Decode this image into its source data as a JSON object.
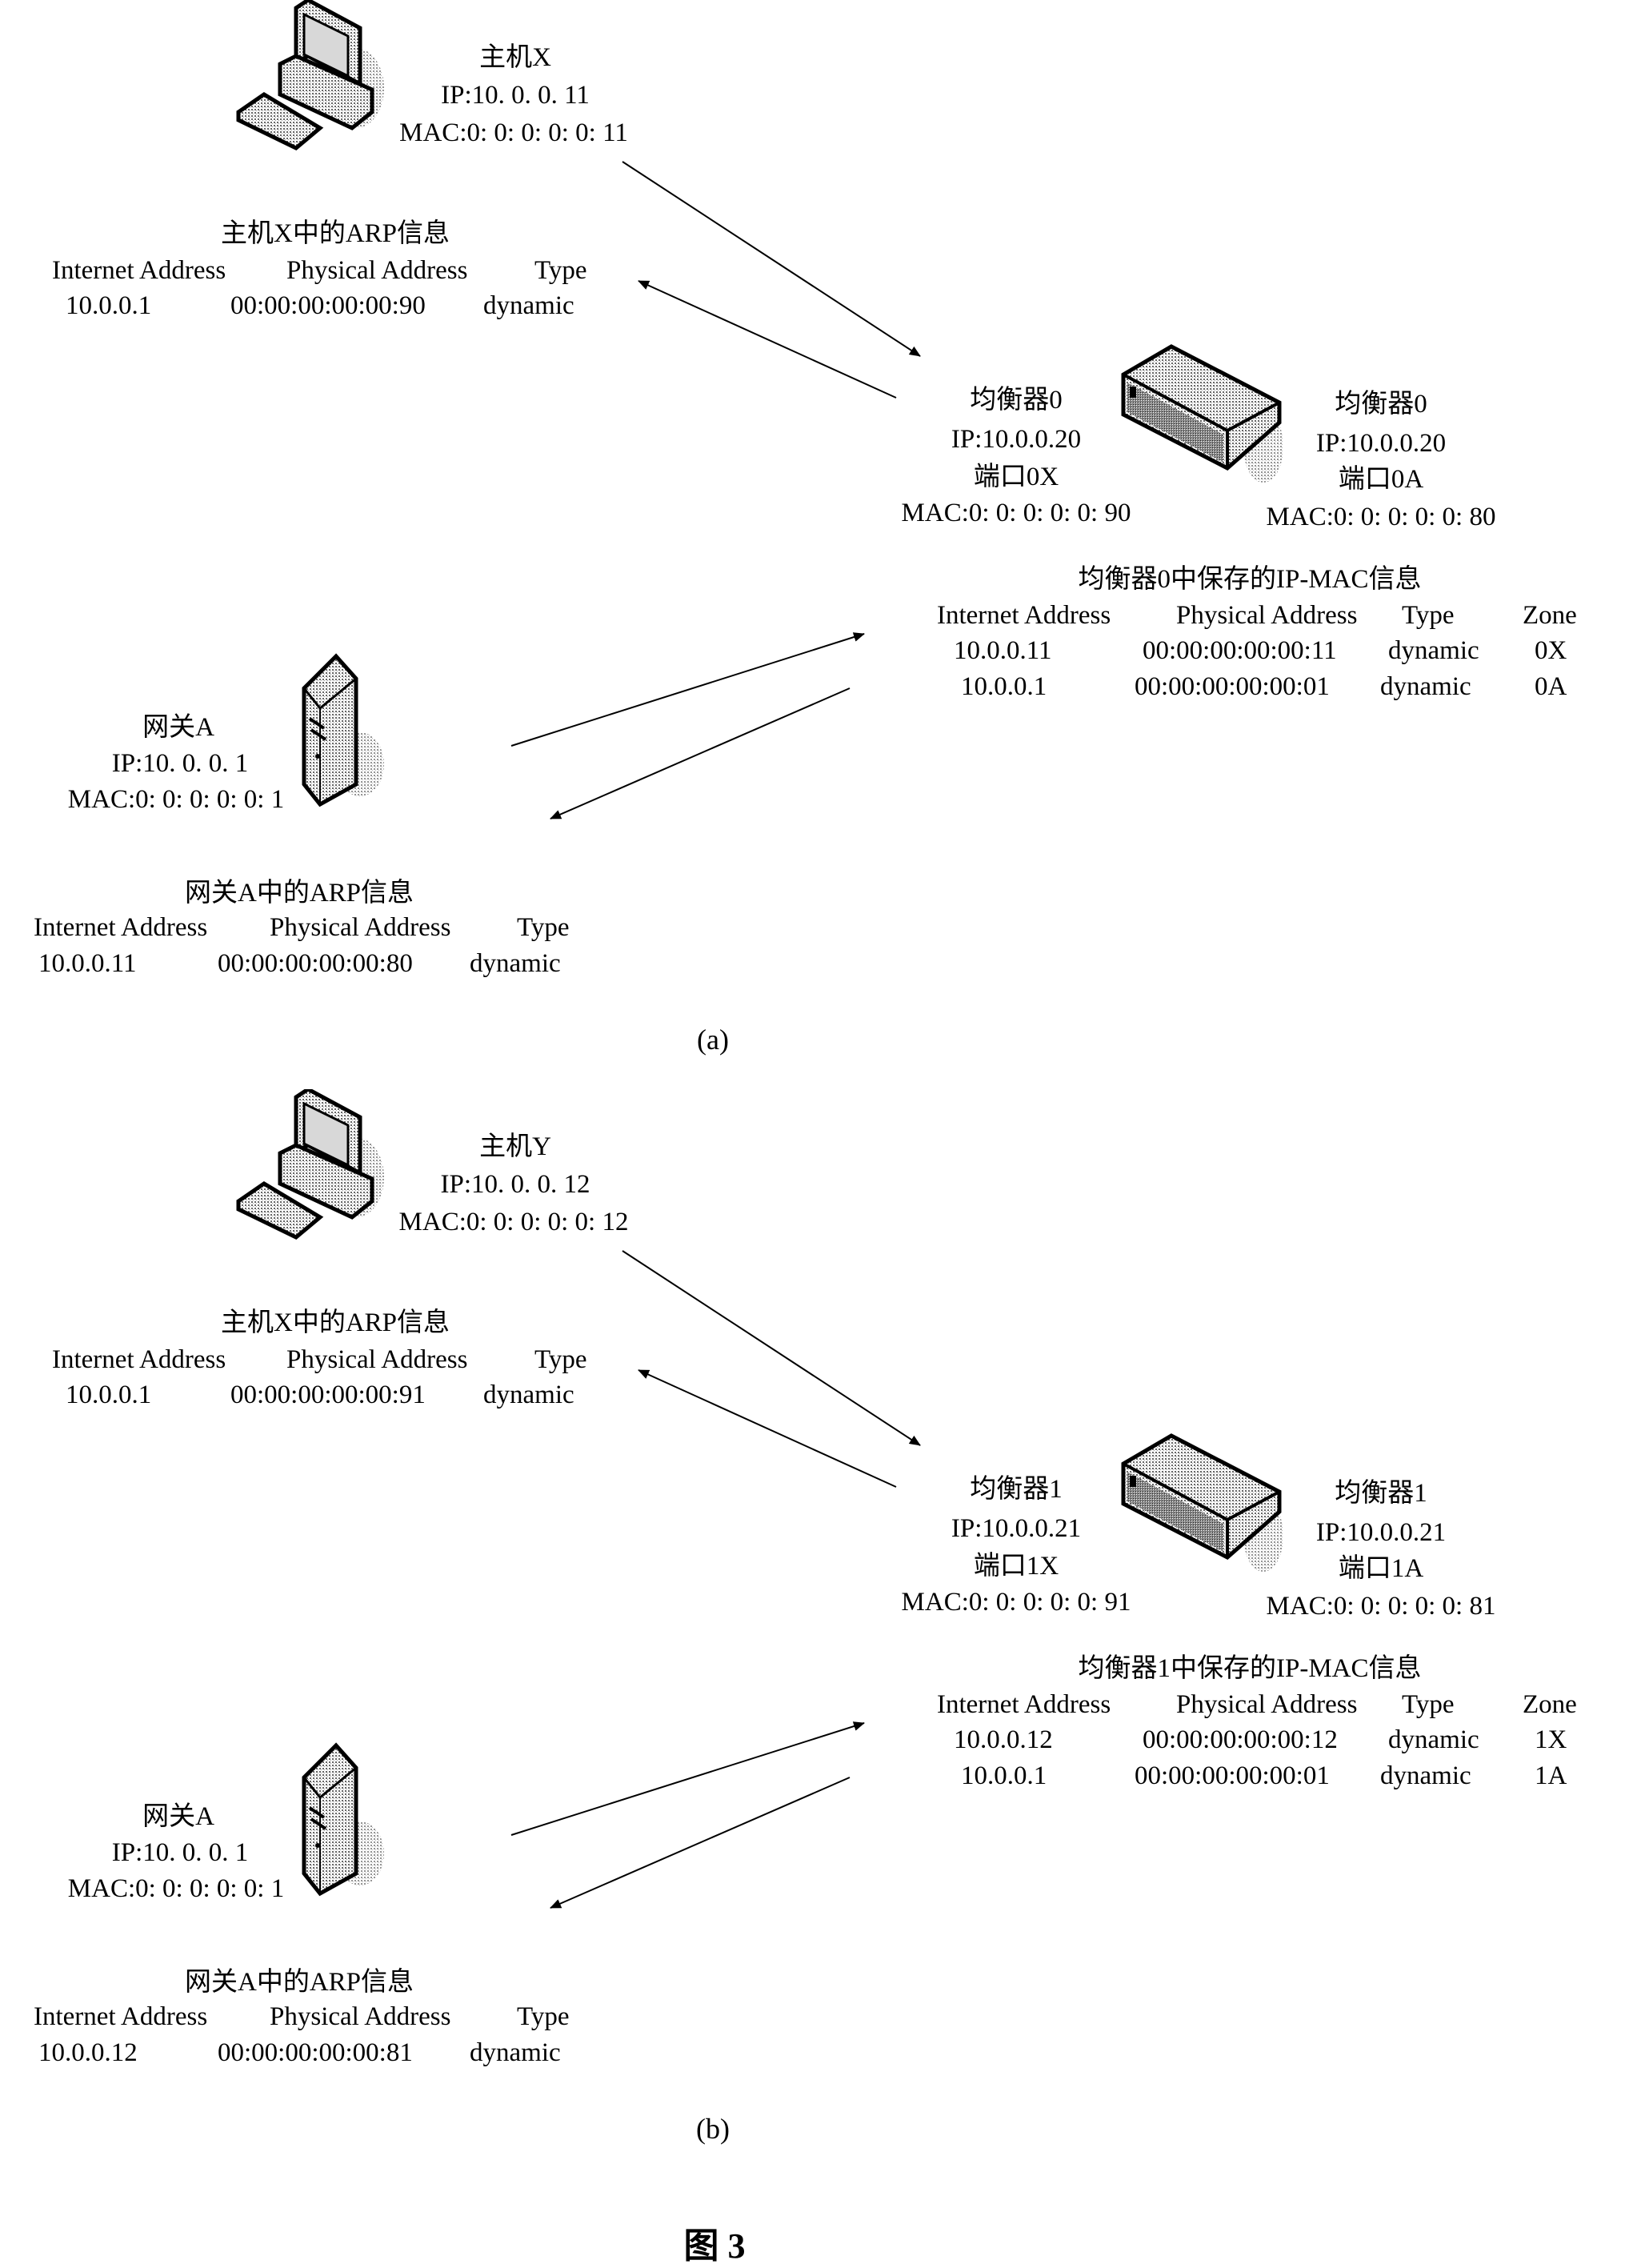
{
  "panels": [
    {
      "caption": "(a)",
      "host": {
        "name": "主机X",
        "ip": "IP:10. 0. 0. 11",
        "mac": "MAC:0: 0: 0: 0: 0: 11",
        "icon": "desktop-computer-icon"
      },
      "host_arp": {
        "title": "主机X中的ARP信息",
        "headers": [
          "Internet Address",
          "Physical Address",
          "Type"
        ],
        "rows": [
          [
            "10.0.0.1",
            "00:00:00:00:00:90",
            "dynamic"
          ]
        ]
      },
      "balancer_left": {
        "name": "均衡器0",
        "ip": "IP:10.0.0.20",
        "port": "端口0X",
        "mac": "MAC:0: 0: 0: 0: 0: 90"
      },
      "balancer_right": {
        "name": "均衡器0",
        "ip": "IP:10.0.0.20",
        "port": "端口0A",
        "mac": "MAC:0: 0: 0: 0: 0: 80"
      },
      "balancer_icon": "network-switch-icon",
      "balancer_table": {
        "title": "均衡器0中保存的IP-MAC信息",
        "headers": [
          "Internet Address",
          "Physical Address",
          "Type",
          "Zone"
        ],
        "rows": [
          [
            "10.0.0.11",
            "00:00:00:00:00:11",
            "dynamic",
            "0X"
          ],
          [
            "10.0.0.1",
            "00:00:00:00:00:01",
            "dynamic",
            "0A"
          ]
        ]
      },
      "gateway": {
        "name": "网关A",
        "ip": "IP:10. 0. 0. 1",
        "mac": "MAC:0: 0: 0: 0: 0: 1",
        "icon": "server-tower-icon"
      },
      "gateway_arp": {
        "title": "网关A中的ARP信息",
        "headers": [
          "Internet Address",
          "Physical Address",
          "Type"
        ],
        "rows": [
          [
            "10.0.0.11",
            "00:00:00:00:00:80",
            "dynamic"
          ]
        ]
      }
    },
    {
      "caption": "(b)",
      "host": {
        "name": "主机Y",
        "ip": "IP:10. 0. 0. 12",
        "mac": "MAC:0: 0: 0: 0: 0: 12",
        "icon": "desktop-computer-icon"
      },
      "host_arp": {
        "title": "主机X中的ARP信息",
        "headers": [
          "Internet Address",
          "Physical Address",
          "Type"
        ],
        "rows": [
          [
            "10.0.0.1",
            "00:00:00:00:00:91",
            "dynamic"
          ]
        ]
      },
      "balancer_left": {
        "name": "均衡器1",
        "ip": "IP:10.0.0.21",
        "port": "端口1X",
        "mac": "MAC:0: 0: 0: 0: 0: 91"
      },
      "balancer_right": {
        "name": "均衡器1",
        "ip": "IP:10.0.0.21",
        "port": "端口1A",
        "mac": "MAC:0: 0: 0: 0: 0: 81"
      },
      "balancer_icon": "network-switch-icon",
      "balancer_table": {
        "title": "均衡器1中保存的IP-MAC信息",
        "headers": [
          "Internet Address",
          "Physical Address",
          "Type",
          "Zone"
        ],
        "rows": [
          [
            "10.0.0.12",
            "00:00:00:00:00:12",
            "dynamic",
            "1X"
          ],
          [
            "10.0.0.1",
            "00:00:00:00:00:01",
            "dynamic",
            "1A"
          ]
        ]
      },
      "gateway": {
        "name": "网关A",
        "ip": "IP:10. 0. 0. 1",
        "mac": "MAC:0: 0: 0: 0: 0: 1",
        "icon": "server-tower-icon"
      },
      "gateway_arp": {
        "title": "网关A中的ARP信息",
        "headers": [
          "Internet Address",
          "Physical Address",
          "Type"
        ],
        "rows": [
          [
            "10.0.0.12",
            "00:00:00:00:00:81",
            "dynamic"
          ]
        ]
      }
    }
  ],
  "figure_label": "图 3"
}
